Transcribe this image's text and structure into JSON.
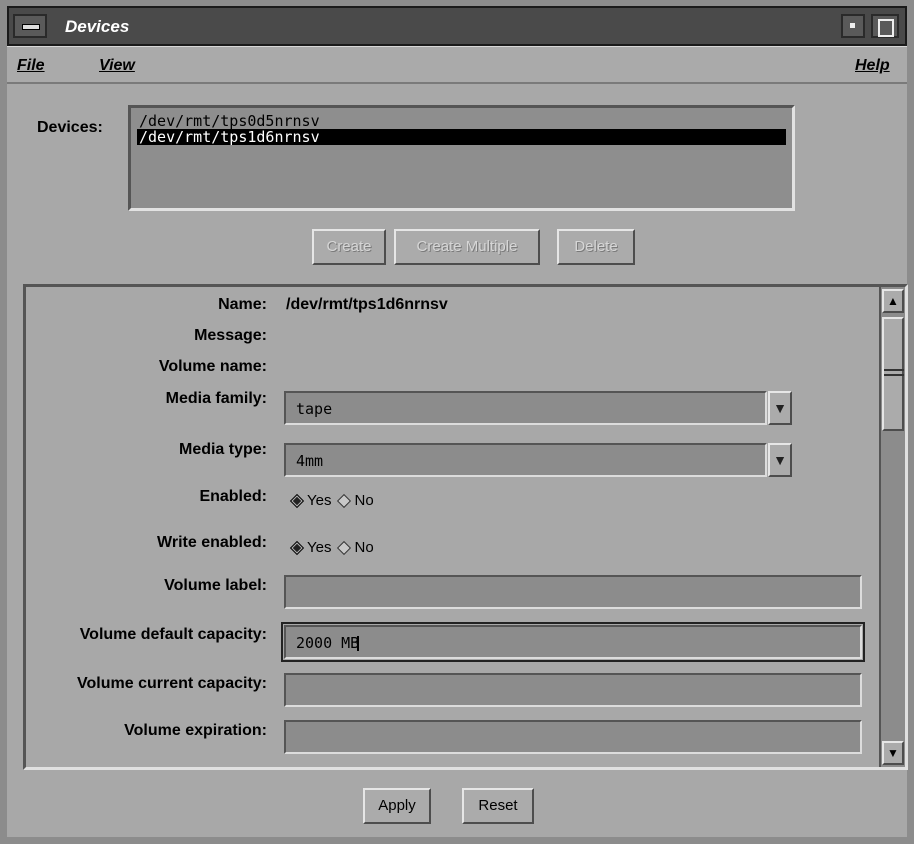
{
  "window": {
    "title": "Devices"
  },
  "menubar": {
    "file": "File",
    "view": "View",
    "help": "Help"
  },
  "devices": {
    "label": "Devices:",
    "items": [
      "/dev/rmt/tps0d5nrnsv",
      "/dev/rmt/tps1d6nrnsv"
    ],
    "selected_index": 1
  },
  "device_buttons": {
    "create": "Create",
    "create_multiple": "Create Multiple",
    "delete": "Delete"
  },
  "form": {
    "name": {
      "label": "Name:",
      "value": "/dev/rmt/tps1d6nrnsv"
    },
    "message": {
      "label": "Message:"
    },
    "volume_name": {
      "label": "Volume name:"
    },
    "media_family": {
      "label": "Media family:",
      "value": "tape"
    },
    "media_type": {
      "label": "Media type:",
      "value": "4mm"
    },
    "enabled": {
      "label": "Enabled:",
      "yes": "Yes",
      "no": "No",
      "selected": "Yes"
    },
    "write_enabled": {
      "label": "Write enabled:",
      "yes": "Yes",
      "no": "No",
      "selected": "Yes"
    },
    "volume_label": {
      "label": "Volume label:",
      "value": ""
    },
    "volume_default_capacity": {
      "label": "Volume default capacity:",
      "value": "2000 MB"
    },
    "volume_current_capacity": {
      "label": "Volume current capacity:",
      "value": ""
    },
    "volume_expiration": {
      "label": "Volume expiration:",
      "value": ""
    }
  },
  "footer": {
    "apply": "Apply",
    "reset": "Reset"
  },
  "icons": {
    "window_menu": "window-menu-icon",
    "minimize": "minimize-icon",
    "maximize": "maximize-icon",
    "dropdown": "triangle-down-icon",
    "scroll_up": "triangle-up-icon",
    "scroll_down": "triangle-down-icon"
  }
}
